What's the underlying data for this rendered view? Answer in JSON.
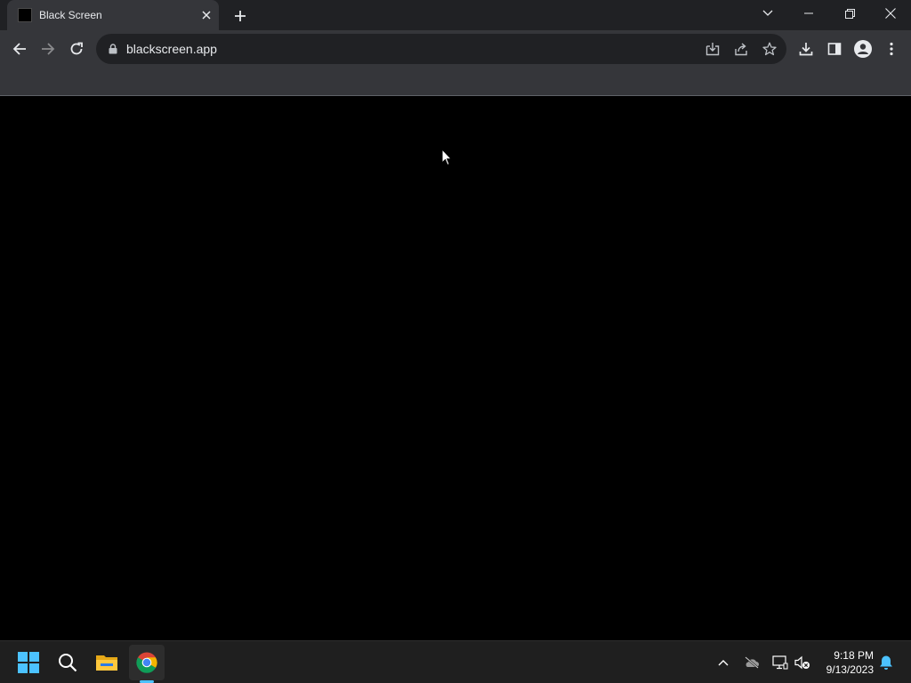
{
  "browser": {
    "tab": {
      "title": "Black Screen",
      "favicon": "black-square-icon"
    },
    "new_tab_icon": "plus-icon",
    "window_controls": [
      "chevron-down-icon",
      "minimize-icon",
      "restore-icon",
      "close-icon"
    ],
    "toolbar": {
      "nav_icons": [
        "back-arrow-icon",
        "forward-arrow-icon",
        "reload-icon"
      ],
      "url": "blackscreen.app",
      "omnibox_icons": [
        "install-app-icon",
        "share-icon",
        "bookmark-star-icon"
      ],
      "right_icons": [
        "download-icon",
        "side-panel-icon",
        "profile-icon",
        "menu-kebab-icon"
      ]
    }
  },
  "page": {
    "background": "#000000"
  },
  "taskbar": {
    "apps": [
      "windows-start-icon",
      "search-icon",
      "file-explorer-icon",
      "chrome-icon"
    ],
    "active_app": "chrome-icon",
    "tray_icons": [
      "chevron-up-icon",
      "onedrive-cloud-off-icon",
      "network-icon",
      "volume-muted-icon",
      "notification-bell-icon"
    ],
    "time": "9:18 PM",
    "date": "9/13/2023",
    "accent_color": "#4cc2ff"
  }
}
